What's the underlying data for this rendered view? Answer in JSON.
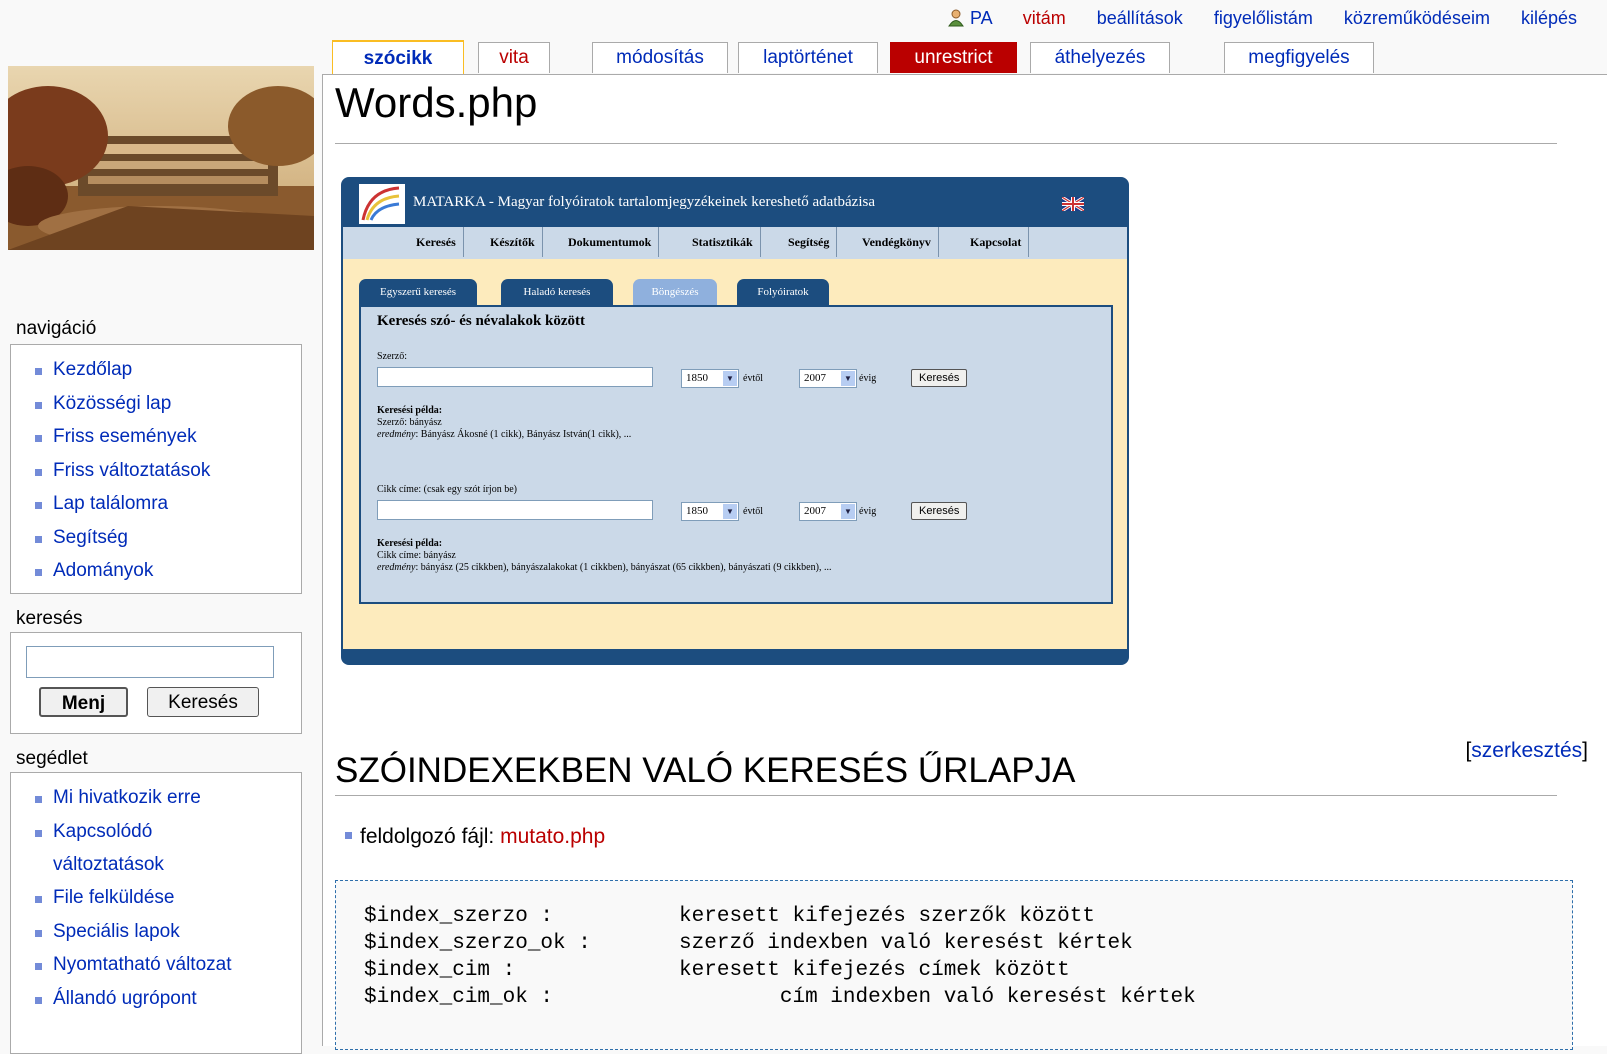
{
  "personal": {
    "username": "PA",
    "links": [
      "vitám",
      "beállítások",
      "figyelőlistám",
      "közreműködéseim",
      "kilépés"
    ]
  },
  "tabs": [
    "szócikk",
    "vita",
    "módosítás",
    "laptörténet",
    "unrestrict",
    "áthelyezés",
    "megfigyelés"
  ],
  "sidebar": {
    "nav_title": "navigáció",
    "nav_items": [
      "Kezdőlap",
      "Közösségi lap",
      "Friss események",
      "Friss változtatások",
      "Lap találomra",
      "Segítség",
      "Adományok"
    ],
    "search_title": "keresés",
    "search_go": "Menj",
    "search_button": "Keresés",
    "tools_title": "segédlet",
    "tools_items": [
      "Mi hivatkozik erre",
      "Kapcsolódó",
      "változtatások",
      "File felküldése",
      "Speciális lapok",
      "Nyomtatható változat",
      "Állandó ugrópont"
    ]
  },
  "page": {
    "title": "Words.php",
    "section_title": "SZÓINDEXEKBEN VALÓ KERESÉS ŰRLAPJA",
    "edit_open": "[",
    "edit_link": "szerkesztés",
    "edit_close": "]",
    "file_label": "feldolgozó fájl: ",
    "file_link": "mutato.php",
    "code_lines": [
      "$index_szerzo :          keresett kifejezés szerzők között",
      "$index_szerzo_ok :       szerző indexben való keresést kértek",
      "$index_cim :             keresett kifejezés címek között",
      "$index_cim_ok :                  cím indexben való keresést kértek"
    ]
  },
  "screenshot": {
    "header": "MATARKA - Magyar folyóiratok tartalomjegyzékeinek kereshető adatbázisa",
    "menu": [
      "Keresés",
      "Készítők",
      "Dokumentumok",
      "Statisztikák",
      "Segítség",
      "Vendégkönyv",
      "Kapcsolat"
    ],
    "subtabs": [
      "Egyszerű keresés",
      "Haladó keresés",
      "Böngészés",
      "Folyóiratok"
    ],
    "panel_title": "Keresés szó- és névalakok között",
    "author_label": "Szerző:",
    "title_label": "Cikk címe: (csak egy szót írjon be)",
    "year_from": "1850",
    "from_suffix": "évtől",
    "year_to": "2007",
    "to_suffix": "évig",
    "search_button": "Keresés",
    "example_label": "Keresési példa:",
    "author_example": "Szerző: bányász",
    "author_result_label": "eredmény",
    "author_result": ": Bányász Ákosné (1 cikk), Bányász István(1 cikk), ...",
    "title_example": "Cikk címe: bányász",
    "title_result_label": "eredmény",
    "title_result": ": bányász (25 cikkben), bányászalakokat (1 cikkben), bányászat (65 cikkben), bányászati (9 cikkben), ..."
  }
}
